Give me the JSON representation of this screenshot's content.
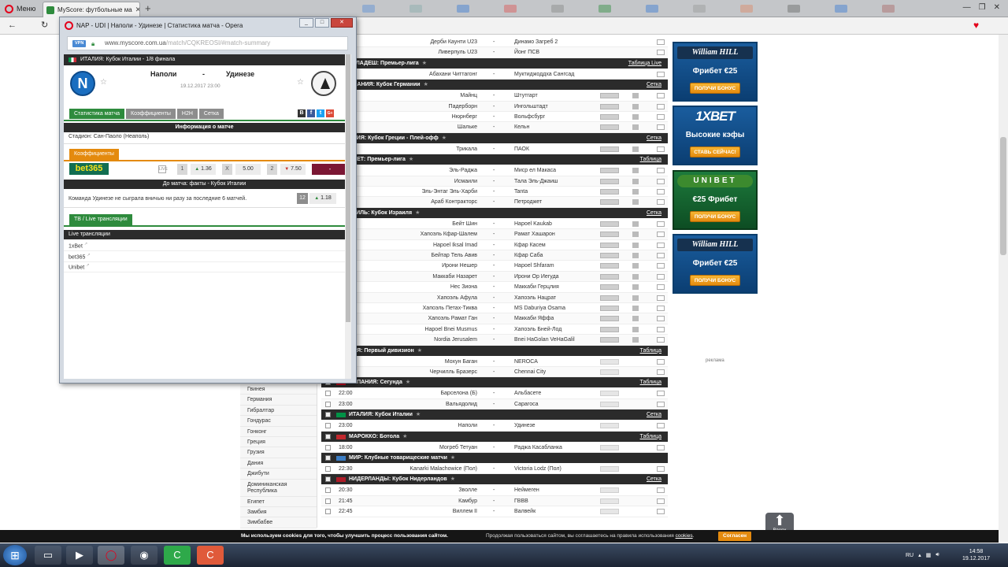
{
  "browser": {
    "menu_label": "Меню",
    "tab_title": "MyScore: футбольные ма",
    "tab_close": "✕",
    "new_tab": "+",
    "back": "←",
    "reload": "↻"
  },
  "popup": {
    "title": "NAP - UDI | Наполи - Удинезе | Статистика матча - Opera",
    "vpn": "VPN",
    "url_domain": "www.myscore.com.ua",
    "url_path": "/match/CQKREOSI/#match-summary",
    "competition": "ИТАЛИЯ: Кубок Италии - 1/8 финала",
    "home_team": "Наполи",
    "away_team": "Удинезе",
    "dash": "-",
    "home_crest_letter": "N",
    "date": "19.12.2017 23:00",
    "tabs": [
      "Статистика матча",
      "Коэффициенты",
      "H2H",
      "Сетка"
    ],
    "share": [
      "B",
      "f",
      "t",
      "G+"
    ],
    "info_header": "Информация о матче",
    "stadium": "Стадион: Сан-Паоло (Неаполь)",
    "odds_tab": "Коэффициенты",
    "bookmaker": "bet365",
    "odds": [
      {
        "label": "1",
        "value": "1.36",
        "dir": "up"
      },
      {
        "label": "X",
        "value": "5.00",
        "dir": "none"
      },
      {
        "label": "2",
        "value": "7.50",
        "dir": "down"
      }
    ],
    "odds_dash": "-",
    "facts_header": "До матча: факты - Кубок Италии",
    "fact_text": "Команда Удинезе не сыграла вничью ни разу за последние 6 матчей.",
    "fact_num": "12",
    "fact_odd": "1.18",
    "tv_tab": "ТВ / Live трансляции",
    "live_header": "Live трансляции",
    "bookmakers": [
      "1xBet",
      "bet365",
      "Unibet"
    ]
  },
  "countries": [
    "Гвинея",
    "Германия",
    "Гибралтар",
    "Гондурас",
    "Гонконг",
    "Греция",
    "Грузия",
    "Дания",
    "Джибути",
    "Доминиканская Республика",
    "Египет",
    "Замбия",
    "Зимбабве"
  ],
  "leagues": [
    {
      "name": "НГЛАДЕШ: Премьер-лига",
      "link": "Таблица Live",
      "flag": "none"
    },
    {
      "name": "РМАНИЯ: Кубок Германии",
      "link": "Сетка",
      "flag": "none"
    },
    {
      "name": "ЕЦИЯ: Кубок Греции - Плей-офф",
      "link": "Сетка",
      "flag": "none"
    },
    {
      "name": "ИПЕТ: Премьер-лига",
      "link": "Таблица",
      "flag": "none"
    },
    {
      "name": "РАИЛЬ: Кубок Израиля",
      "link": "Сетка",
      "flag": "none"
    },
    {
      "name": "ДИЯ: Первый дивизион",
      "link": "Таблица",
      "flag": "none"
    },
    {
      "name": "ИСПАНИЯ: Сегунда",
      "link": "Таблица",
      "flag": "#c60b1e"
    },
    {
      "name": "ИТАЛИЯ: Кубок Италии",
      "link": "Сетка",
      "flag": "#009246"
    },
    {
      "name": "МАРОККО: Ботола",
      "link": "Таблица",
      "flag": "#c1272d"
    },
    {
      "name": "МИР: Клубные товарищеские матчи",
      "link": "",
      "flag": "#3b7dc4"
    },
    {
      "name": "НИДЕРЛАНДЫ: Кубок Нидерландов",
      "link": "Сетка",
      "flag": "#ae1c28"
    }
  ],
  "matches": [
    {
      "time": "",
      "home": "Дерби Каунти U23",
      "away": "Динамо Загреб 2"
    },
    {
      "time": "",
      "home": "Ливерпуль U23",
      "away": "Йонг ПСВ"
    },
    {
      "time": "",
      "home": "Абахани Читтагонг",
      "away": "Муктиджоддха Сангсад"
    },
    {
      "time": "",
      "home": "Майнц",
      "away": "Штутгарт"
    },
    {
      "time": "",
      "home": "Падерборн",
      "away": "Ингольштадт"
    },
    {
      "time": "",
      "home": "Нюрнберг",
      "away": "Вольфсбург"
    },
    {
      "time": "",
      "home": "Шальке",
      "away": "Кельн"
    },
    {
      "time": "",
      "home": "Трикала",
      "away": "ПАОК"
    },
    {
      "time": "",
      "home": "Эль-Раджа",
      "away": "Миср ел Макаса"
    },
    {
      "time": "",
      "home": "Исмаили",
      "away": "Тала Эль-Джаиш"
    },
    {
      "time": "",
      "home": "Эль-Энтаг Эль-Харби",
      "away": "Tanta"
    },
    {
      "time": "",
      "home": "Араб Контракторс",
      "away": "Петроджет"
    },
    {
      "time": "",
      "home": "Бейт Шин",
      "away": "Hapoel Kaukab"
    },
    {
      "time": "",
      "home": "Хапоэль Кфар-Шалем",
      "away": "Рамат Хашарон"
    },
    {
      "time": "",
      "home": "Hapoel Iksal Imad",
      "away": "Кфар Касем"
    },
    {
      "time": "",
      "home": "Бейтар Тель Авив",
      "away": "Кфар Саба"
    },
    {
      "time": "",
      "home": "Ирони Нешер",
      "away": "Hapoel Shfaram"
    },
    {
      "time": "",
      "home": "Маккаби Назарет",
      "away": "Ирони Ор Иегуда"
    },
    {
      "time": "",
      "home": "Нес Зиона",
      "away": "Маккаби Герцлия"
    },
    {
      "time": "",
      "home": "Хапоэль Афула",
      "away": "Хапоэль Нацрат"
    },
    {
      "time": "",
      "home": "Хапоэль Петах-Тиква",
      "away": "MS Daburiya Osama"
    },
    {
      "time": "",
      "home": "Хапоэль Рамат Ган",
      "away": "Маккаби Яффа"
    },
    {
      "time": "",
      "home": "Hapoel Bnei Musmus",
      "away": "Хапоэль Бней-Лод"
    },
    {
      "time": "",
      "home": "Nordia Jerusalem",
      "away": "Bnei HaGolan VeHaGalil"
    },
    {
      "time": "",
      "home": "Мохун Баган",
      "away": "NEROCA"
    },
    {
      "time": "",
      "home": "Черчилль Бразерс",
      "away": "Chennai City"
    },
    {
      "time": "22:00",
      "home": "Барселона (Б)",
      "away": "Альбасете"
    },
    {
      "time": "23:00",
      "home": "Вальядолид",
      "away": "Сарагоса"
    },
    {
      "time": "23:00",
      "home": "Наполи",
      "away": "Удинезе"
    },
    {
      "time": "18:00",
      "home": "Могреб Тетуан",
      "away": "Раджа Касабланка"
    },
    {
      "time": "22:30",
      "home": "Kanarki Malachowice (Пол)",
      "away": "Victoria Lodz (Пол)"
    },
    {
      "time": "20:30",
      "home": "Зволле",
      "away": "Неймеген"
    },
    {
      "time": "21:45",
      "home": "Камбур",
      "away": "ГВВВ"
    },
    {
      "time": "22:45",
      "home": "Виллем II",
      "away": "Валвейк"
    }
  ],
  "ads": [
    {
      "logo": "William HILL",
      "text": "Фрибет €25",
      "button": "ПОЛУЧИ БОНУС"
    },
    {
      "logo": "1XBET",
      "text": "Высокие кэфы",
      "button": "СТАВЬ СЕЙЧАС!"
    },
    {
      "logo": "UNIBET",
      "text": "€25 Фрибет",
      "button": "ПОЛУЧИ БОНУС"
    },
    {
      "logo": "William HILL",
      "text": "Фрибет €25",
      "button": "ПОЛУЧИ БОНУС"
    }
  ],
  "ad_label": "реклама",
  "up_button": "Вверх",
  "cookie": {
    "bold": "Мы используем cookies для того, чтобы улучшить процесс пользования сайтом.",
    "rest": "Продолжая пользоваться сайтом, вы соглашаетесь на правила использования",
    "link": "cookies",
    "button": "Согласен"
  },
  "taskbar": {
    "lang": "RU",
    "time": "14:58",
    "date": "19.12.2017"
  },
  "colors": {
    "accent_green": "#2e8b3d",
    "dark_bar": "#2b2b2b",
    "orange": "#e48a0e",
    "bet365": "#126e51"
  }
}
